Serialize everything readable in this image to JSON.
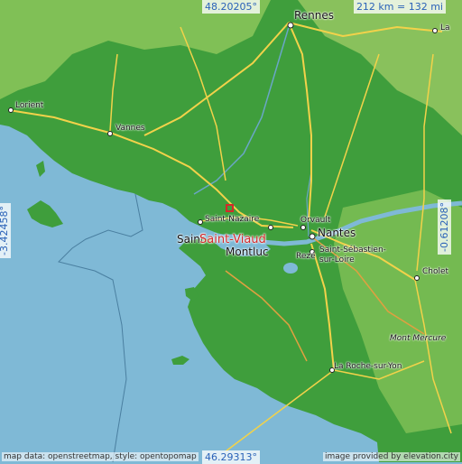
{
  "coordinates": {
    "top_latitude": "48.20205°",
    "bottom_latitude": "46.29313°",
    "left_longitude": "-3.42458°",
    "right_longitude": "-0.61208°"
  },
  "scale": "212 km = 132 mi",
  "credits": {
    "left": "map data: openstreetmap, style: opentopomap",
    "right": "image provided by elevation.city"
  },
  "main_place": "Saint-Viaud",
  "cities": {
    "rennes": "Rennes",
    "lorient": "Lorient",
    "vannes": "Vannes",
    "saint_nazaire": "Saint-Nazaire",
    "orvault": "Orvault",
    "nantes": "Nantes",
    "saint_sebastien": "Saint-Sébastien-\nsur-Loire",
    "reze": "Rezé",
    "montluc": "Montluc",
    "saint_etienne_part": "Saint",
    "cholet": "Cholet",
    "mont_mercure": "Mont Mercure",
    "la_roche": "La Roche-sur-Yon",
    "la_label": "La"
  },
  "colors": {
    "sea": "#7fb9d6",
    "land": "#3f9e3c",
    "land_light": "#8cc65a",
    "road": "#f2d24a",
    "highway": "#e0a040",
    "marker": "#d42a2a"
  }
}
